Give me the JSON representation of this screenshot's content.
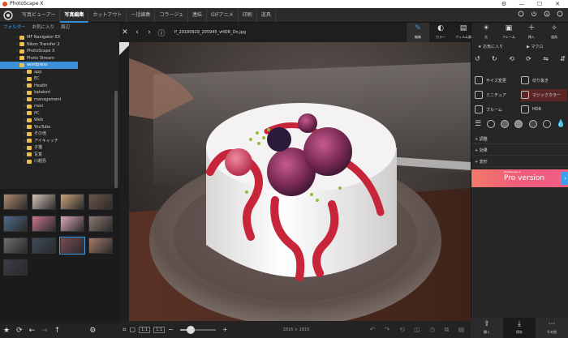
{
  "window": {
    "title": "PhotoScape X",
    "controls": {
      "settings": "⚙",
      "minimize": "—",
      "maximize": "☐",
      "close": "✕"
    }
  },
  "menu": {
    "items": [
      "写真ビューアー",
      "写真編集",
      "カットアウト",
      "一括編集",
      "コラージュ",
      "連結",
      "GIFアニメ",
      "印刷",
      "道具"
    ],
    "active_index": 1
  },
  "top_icons": [
    "settings-icon",
    "power-icon",
    "info-icon",
    "help-icon"
  ],
  "folder_panel": {
    "tabs": [
      "フォルダー",
      "お気に入り",
      "周辺"
    ],
    "active_tab": 0,
    "items": [
      {
        "label": "MF Navigator EX",
        "level": 2
      },
      {
        "label": "Nikon Transfer 2",
        "level": 2
      },
      {
        "label": "PhotoScape X",
        "level": 2
      },
      {
        "label": "Photo Stream",
        "level": 2
      },
      {
        "label": "wordpress",
        "level": 2,
        "selected": true,
        "expanded": true
      },
      {
        "label": "app",
        "level": 3
      },
      {
        "label": "EC",
        "level": 3
      },
      {
        "label": "Health",
        "level": 3
      },
      {
        "label": "katakori",
        "level": 3
      },
      {
        "label": "management",
        "level": 3
      },
      {
        "label": "mori",
        "level": 3
      },
      {
        "label": "PC",
        "level": 3
      },
      {
        "label": "Web",
        "level": 3
      },
      {
        "label": "YouTube",
        "level": 3
      },
      {
        "label": "その他",
        "level": 3
      },
      {
        "label": "アイキャッチ",
        "level": 3
      },
      {
        "label": "子猫",
        "level": 3
      },
      {
        "label": "写真",
        "level": 3
      },
      {
        "label": "川越島",
        "level": 3
      }
    ]
  },
  "thumbnails": {
    "colors": [
      [
        "#b08a6e",
        "#d4c2b8",
        "#c9a07a",
        "#6b5547"
      ],
      [
        "#4c6b88",
        "#c8748c",
        "#d9a6b4",
        "#8b7770"
      ],
      [
        "#6d6d6d",
        "#3d4a5a",
        "#7a4b55",
        "#a37b6a"
      ],
      [
        "#3f3a4a"
      ]
    ],
    "selected": [
      2,
      2
    ]
  },
  "left_bottom_icons": [
    "star-icon",
    "refresh-icon",
    "back-arrow-icon",
    "forward-arrow-icon",
    "up-arrow-icon",
    "settings-icon"
  ],
  "viewer": {
    "filename": "P_20180929_205945_vHDR_On.jpg",
    "zoom_buttons": [
      "1:1",
      "1:1"
    ],
    "dimensions": "2816 × 2816",
    "slider_fraction": 0.3,
    "bottom_icons": [
      "undo-icon",
      "redo-icon",
      "undo-all-icon",
      "compare-icon",
      "history-icon",
      "copy-icon",
      "paste-icon"
    ]
  },
  "tool_tabs": [
    {
      "label": "編集",
      "icon": "✎"
    },
    {
      "label": "カラー",
      "icon": "◐"
    },
    {
      "label": "フィルム調",
      "icon": "▤"
    },
    {
      "label": "光",
      "icon": "☀"
    },
    {
      "label": "フレーム",
      "icon": "▣"
    },
    {
      "label": "挿入",
      "icon": "＋"
    },
    {
      "label": "道具",
      "icon": "✧"
    }
  ],
  "right_panel": {
    "favorites_label": "お気に入り",
    "macro_label": "マクロ",
    "rotate_icons": [
      "↺",
      "↻",
      "⟲",
      "⟳",
      "⇋",
      "⇵"
    ],
    "tools": [
      [
        "サイズ変更",
        "切り抜き"
      ],
      [
        "ミニチュア",
        "マジックカラー"
      ],
      [
        "ブルーム",
        "HDR"
      ]
    ],
    "sections": [
      "調整",
      "効果",
      "変形"
    ],
    "pro_small": "PhotoScape X",
    "pro_label": "Pro version",
    "pro_arrow": "›"
  },
  "right_bottom": [
    {
      "label": "開く",
      "icon": "⇪"
    },
    {
      "label": "保存",
      "icon": "⤓"
    },
    {
      "label": "その他",
      "icon": "⋯"
    }
  ]
}
